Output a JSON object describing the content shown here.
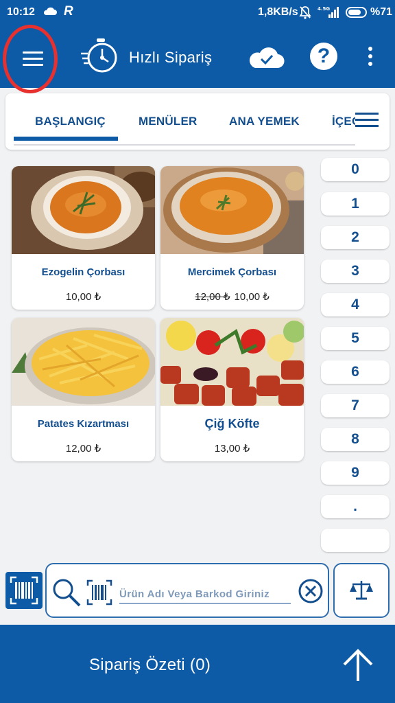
{
  "status_bar": {
    "time": "10:12",
    "r_icon": "R",
    "net_speed": "1,8KB/s",
    "network_label": "4.5G",
    "battery_percent": "%71"
  },
  "header": {
    "title": "Hızlı Sipariş",
    "help_label": "?",
    "icons": [
      "menu-icon",
      "stopwatch-icon",
      "cloud-sync-icon",
      "help-icon",
      "more-vert-icon"
    ],
    "highlight_color": "#e8302f"
  },
  "colors": {
    "primary": "#0d5ba6",
    "text_blue": "#134f8f",
    "background": "#f1f2f4"
  },
  "categories": {
    "tabs": [
      {
        "label": "BAŞLANGIÇ",
        "selected": true
      },
      {
        "label": "MENÜLER",
        "selected": false
      },
      {
        "label": "ANA YEMEK",
        "selected": false
      },
      {
        "label": "İÇECEK",
        "selected": false
      }
    ]
  },
  "products": [
    {
      "name": "Ezogelin Çorbası",
      "old_price": "",
      "price": "10,00 ₺",
      "image": "soup-bowl-image"
    },
    {
      "name": "Mercimek Çorbası",
      "old_price": "12,00 ₺",
      "price": "10,00 ₺",
      "image": "lentil-soup-image"
    },
    {
      "name": "Patates Kızartması",
      "old_price": "",
      "price": "12,00 ₺",
      "image": "french-fries-image"
    },
    {
      "name": "Çiğ Köfte",
      "old_price": "",
      "price": "13,00 ₺",
      "image": "cig-kofte-image"
    }
  ],
  "keypad": {
    "keys": [
      "0",
      "1",
      "2",
      "3",
      "4",
      "5",
      "6",
      "7",
      "8",
      "9",
      ".",
      ""
    ]
  },
  "search": {
    "placeholder": "Ürün Adı Veya Barkod Giriniz",
    "value": ""
  },
  "footer": {
    "order_summary": "Sipariş Özeti (0)"
  }
}
